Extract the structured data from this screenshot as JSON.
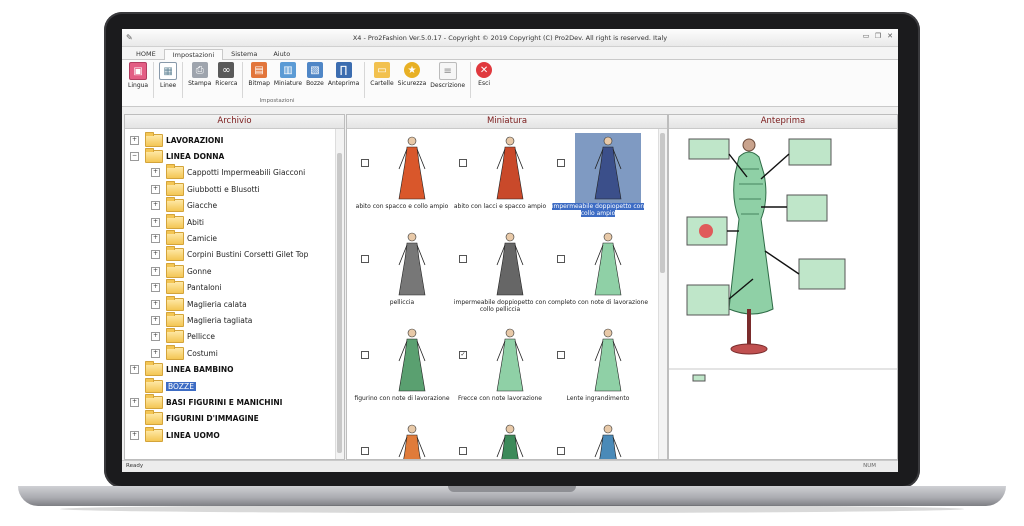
{
  "window": {
    "title": "X4 - Pro2Fashion Ver.5.0.17 - Copyright © 2019 Copyright (C) Pro2Dev. All right is reserved. Italy"
  },
  "menu_tabs": [
    "HOME",
    "Impostazioni",
    "Sistema",
    "Aiuto"
  ],
  "ribbon": {
    "buttons": [
      "Lingua",
      "Linee",
      "Stampa",
      "Ricerca",
      "Bitmap",
      "Miniature",
      "Bozze",
      "Anteprima",
      "Cartelle",
      "Sicurezza",
      "Descrizione",
      "Esci"
    ],
    "group_caption": "Impostazioni"
  },
  "panes": {
    "archivio": "Archivio",
    "miniatura": "Miniatura",
    "anteprima": "Anteprima"
  },
  "tree": [
    {
      "label": "LAVORAZIONI",
      "top": true,
      "exp": "+"
    },
    {
      "label": "LINEA DONNA",
      "top": true,
      "exp": "−"
    },
    {
      "label": "Cappotti Impermeabili Giacconi",
      "exp": "+"
    },
    {
      "label": "Giubbotti e Blusotti",
      "exp": "+"
    },
    {
      "label": "Giacche",
      "exp": "+"
    },
    {
      "label": "Abiti",
      "exp": "+"
    },
    {
      "label": "Camicie",
      "exp": "+"
    },
    {
      "label": "Corpini Bustini Corsetti Gilet Top",
      "exp": "+"
    },
    {
      "label": "Gonne",
      "exp": "+"
    },
    {
      "label": "Pantaloni",
      "exp": "+"
    },
    {
      "label": "Maglieria calata",
      "exp": "+"
    },
    {
      "label": "Maglieria tagliata",
      "exp": "+"
    },
    {
      "label": "Pellicce",
      "exp": "+"
    },
    {
      "label": "Costumi",
      "exp": "+"
    },
    {
      "label": "LINEA BAMBINO",
      "top": true,
      "exp": "+"
    },
    {
      "label": "BOZZE",
      "top": true,
      "exp": "",
      "selected": true
    },
    {
      "label": "BASI FIGURINI E MANICHINI",
      "top": true,
      "exp": "+"
    },
    {
      "label": "FIGURINI D'IMMAGINE",
      "top": true,
      "exp": ""
    },
    {
      "label": "LINEA UOMO",
      "top": true,
      "exp": "+"
    }
  ],
  "thumbnails": [
    {
      "caption": "abito con spacco e collo ampio",
      "checked": false
    },
    {
      "caption": "abito con lacci e spacco ampio",
      "checked": false
    },
    {
      "caption": "impermeabile doppiopetto con collo ampio",
      "checked": false,
      "selected": true
    },
    {
      "caption": "pelliccia",
      "checked": false
    },
    {
      "caption": "impermeabile doppiopetto con collo pelliccia",
      "checked": false
    },
    {
      "caption": "completo con note di lavorazione",
      "checked": false
    },
    {
      "caption": "figurino con note di lavorazione",
      "checked": false
    },
    {
      "caption": "Frecce con note lavorazione",
      "checked": true
    },
    {
      "caption": "Lente ingrandimento",
      "checked": false
    },
    {
      "caption": "",
      "checked": false
    },
    {
      "caption": "",
      "checked": false
    },
    {
      "caption": "",
      "checked": false
    }
  ],
  "status": {
    "left": "Ready",
    "right": "NUM"
  }
}
